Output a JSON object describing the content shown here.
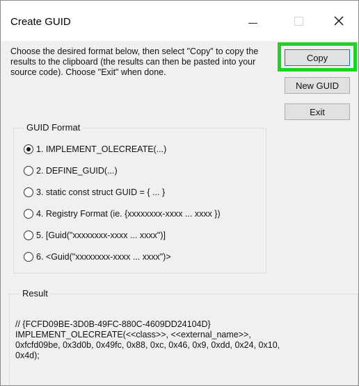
{
  "window": {
    "title": "Create GUID"
  },
  "instructions": "Choose the desired format below, then select \"Copy\" to copy the results to the clipboard (the results can then be pasted into your source code). Choose \"Exit\" when done.",
  "buttons": {
    "copy": "Copy",
    "new_guid": "New GUID",
    "exit": "Exit"
  },
  "highlight_color": "#22d02a",
  "guid_format": {
    "legend": "GUID Format",
    "selected_index": 0,
    "options": [
      "1. IMPLEMENT_OLECREATE(...)",
      "2. DEFINE_GUID(...)",
      "3. static const struct GUID = { ... }",
      "4. Registry Format (ie. {xxxxxxxx-xxxx ... xxxx })",
      "5. [Guid(\"xxxxxxxx-xxxx ... xxxx\")]",
      "6. <Guid(\"xxxxxxxx-xxxx ... xxxx\")>"
    ]
  },
  "result": {
    "legend": "Result",
    "text": "// {FCFD09BE-3D0B-49FC-880C-4609DD24104D}\nIMPLEMENT_OLECREATE(<<class>>, <<external_name>>,\n0xfcfd09be, 0x3d0b, 0x49fc, 0x88, 0xc, 0x46, 0x9, 0xdd, 0x24, 0x10,\n0x4d);"
  }
}
